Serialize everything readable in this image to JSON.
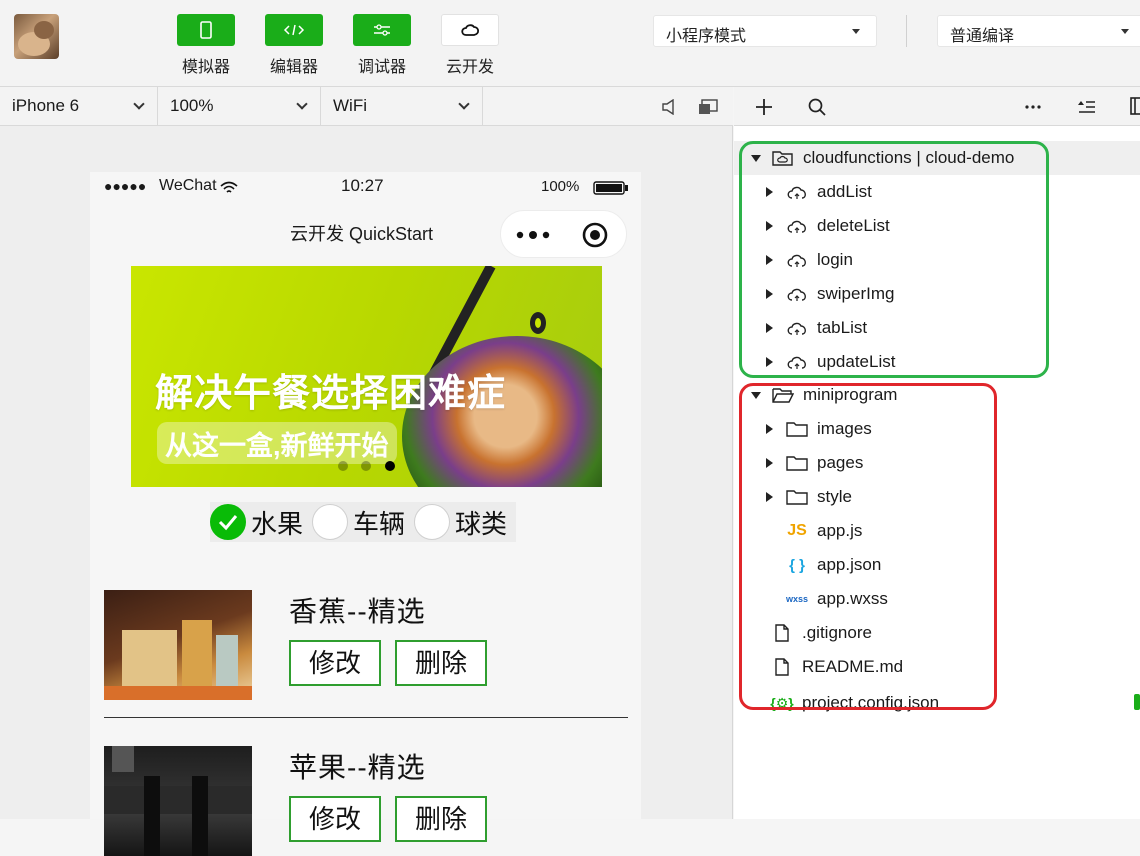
{
  "toolbar": {
    "buttons": [
      {
        "label": "模拟器",
        "icon": "phone-icon"
      },
      {
        "label": "编辑器",
        "icon": "code-icon"
      },
      {
        "label": "调试器",
        "icon": "debug-icon"
      },
      {
        "label": "云开发",
        "icon": "cloud-icon"
      }
    ],
    "mode_select": "小程序模式",
    "compile_select": "普通编译"
  },
  "device_bar": {
    "device": "iPhone 6",
    "zoom": "100%",
    "network": "WiFi"
  },
  "phone": {
    "status": {
      "signal": "●●●●●",
      "carrier": "WeChat",
      "time": "10:27",
      "battery": "100%"
    },
    "nav_title": "云开发 QuickStart",
    "banner": {
      "headline": "解决午餐选择困难症",
      "subline": "从这一盒,新鲜开始"
    },
    "radios": [
      {
        "label": "水果",
        "checked": true
      },
      {
        "label": "车辆",
        "checked": false
      },
      {
        "label": "球类",
        "checked": false
      }
    ],
    "items": [
      {
        "title": "香蕉--精选",
        "edit": "修改",
        "delete": "删除"
      },
      {
        "title": "苹果--精选",
        "edit": "修改",
        "delete": "删除"
      }
    ]
  },
  "tree": {
    "cloud_root": "cloudfunctions | cloud-demo",
    "cloud_items": [
      "addList",
      "deleteList",
      "login",
      "swiperImg",
      "tabList",
      "updateList"
    ],
    "mini_root": "miniprogram",
    "mini_folders": [
      "images",
      "pages",
      "style"
    ],
    "mini_files": [
      {
        "name": "app.js",
        "badge": "JS"
      },
      {
        "name": "app.json",
        "badge": "{ }"
      },
      {
        "name": "app.wxss",
        "badge": "wxss"
      }
    ],
    "root_files": [
      ".gitignore",
      "README.md",
      "project.config.json"
    ]
  },
  "colors": {
    "green": "#1aad19",
    "highlight_green": "#2db34a",
    "highlight_red": "#e0262b"
  }
}
